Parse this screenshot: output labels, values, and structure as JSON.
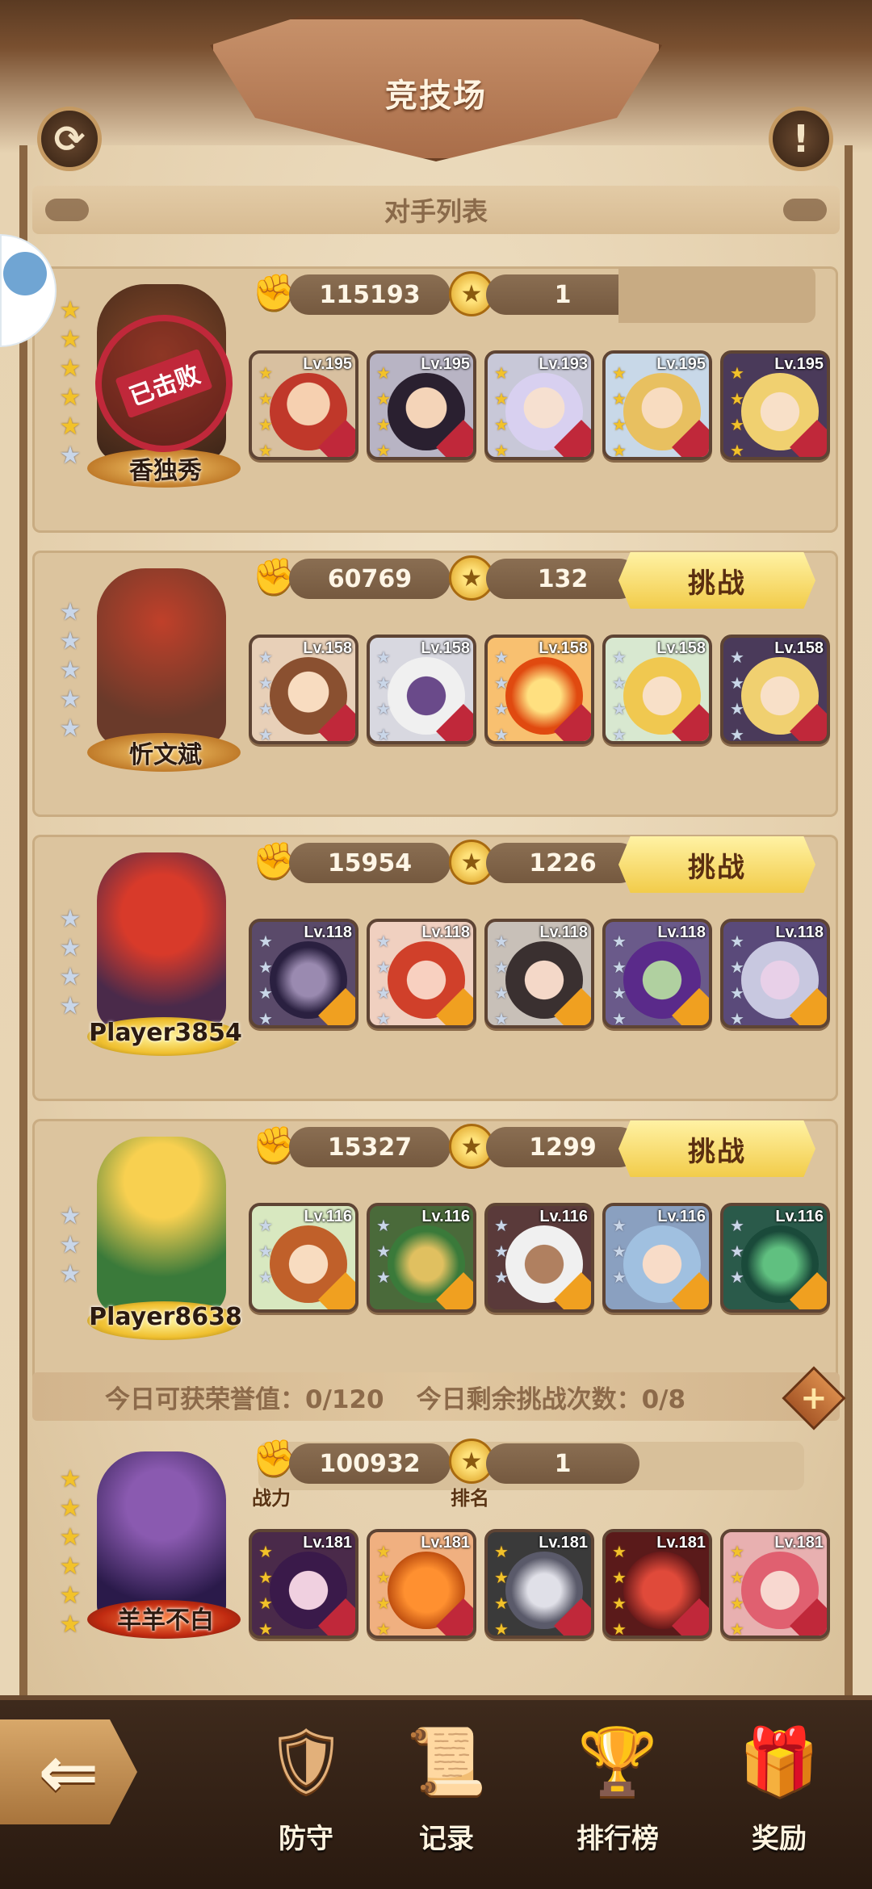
{
  "header": {
    "title": "竞技场",
    "subtitle": "对手列表"
  },
  "colors": {
    "accent_gold": "#f2cc4a",
    "star_gold": "#f2c22a",
    "star_silver": "#c9d6e8",
    "defeated_red": "#c0283a",
    "parchment": "#e7d3b2"
  },
  "opponents": [
    {
      "name": "香独秀",
      "power": "115193",
      "rank": "1",
      "defeated": true,
      "defeated_label": "已击败",
      "stars": 6,
      "gold_stars": 5,
      "heroes": [
        {
          "level": "Lv.195",
          "icon": "red-hair-warrior"
        },
        {
          "level": "Lv.195",
          "icon": "dark-swordsman"
        },
        {
          "level": "Lv.193",
          "icon": "silver-paladin"
        },
        {
          "level": "Lv.195",
          "icon": "blonde-knight"
        },
        {
          "level": "Lv.195",
          "icon": "witch-hat-mage"
        }
      ]
    },
    {
      "name": "忻文斌",
      "power": "60769",
      "rank": "132",
      "challenge_label": "挑战",
      "stars": 5,
      "gold_stars": 0,
      "heroes": [
        {
          "level": "Lv.158",
          "icon": "brown-hair-girl"
        },
        {
          "level": "Lv.158",
          "icon": "white-beast"
        },
        {
          "level": "Lv.158",
          "icon": "phoenix"
        },
        {
          "level": "Lv.158",
          "icon": "elf-princess"
        },
        {
          "level": "Lv.158",
          "icon": "witch-hat-mage"
        }
      ]
    },
    {
      "name": "Player3854",
      "power": "15954",
      "rank": "1226",
      "challenge_label": "挑战",
      "stars": 4,
      "gold_stars": 0,
      "heroes": [
        {
          "level": "Lv.118",
          "icon": "shadow-golem"
        },
        {
          "level": "Lv.118",
          "icon": "red-demon"
        },
        {
          "level": "Lv.118",
          "icon": "horned-valkyrie"
        },
        {
          "level": "Lv.118",
          "icon": "purple-orc"
        },
        {
          "level": "Lv.118",
          "icon": "dark-elf"
        }
      ]
    },
    {
      "name": "Player8638",
      "power": "15327",
      "rank": "1299",
      "challenge_label": "挑战",
      "stars": 3,
      "gold_stars": 0,
      "heroes": [
        {
          "level": "Lv.116",
          "icon": "dryad"
        },
        {
          "level": "Lv.116",
          "icon": "tree-golem"
        },
        {
          "level": "Lv.116",
          "icon": "white-hair-assassin"
        },
        {
          "level": "Lv.116",
          "icon": "blue-hair-elf"
        },
        {
          "level": "Lv.116",
          "icon": "green-dragon"
        }
      ]
    }
  ],
  "info_bar": {
    "honor_today": "今日可获荣誉值：0/120",
    "challenges_left": "今日剩余挑战次数：0/8"
  },
  "my_team": {
    "name": "羊羊不白",
    "power": "100932",
    "rank": "1",
    "power_label": "战力",
    "rank_label": "排名",
    "stars": 6,
    "gold_stars": 6,
    "heroes": [
      {
        "level": "Lv.181",
        "icon": "vampire-girl"
      },
      {
        "level": "Lv.181",
        "icon": "pumpkin-head"
      },
      {
        "level": "Lv.181",
        "icon": "silver-dragon"
      },
      {
        "level": "Lv.181",
        "icon": "red-dragon"
      },
      {
        "level": "Lv.181",
        "icon": "pink-hair-succubus"
      }
    ]
  },
  "nav": {
    "defense": "防守",
    "records": "记录",
    "leaderboard": "排行榜",
    "rewards": "奖励"
  }
}
